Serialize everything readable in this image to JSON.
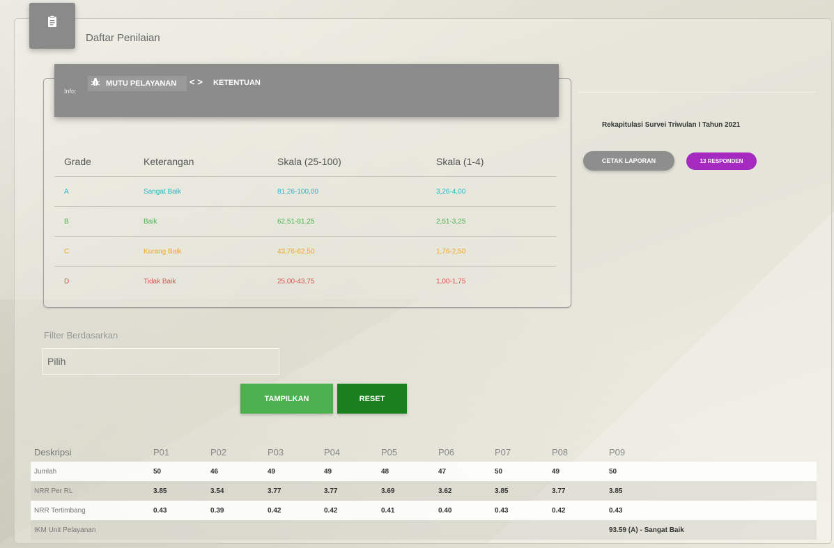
{
  "card": {
    "title": "Daftar Penilaian"
  },
  "info_bar": {
    "label": "Info:",
    "tab_mutu": "MUTU PELAYANAN",
    "tab_ketentuan": "KETENTUAN"
  },
  "grade_table": {
    "headers": [
      "Grade",
      "Keterangan",
      "Skala (25-100)",
      "Skala (1-4)"
    ],
    "rows": [
      {
        "grade": "A",
        "keterangan": "Sangat Baik",
        "skala100": "81,26-100,00",
        "skala4": "3,26-4,00",
        "color": "#29b6c8"
      },
      {
        "grade": "B",
        "keterangan": "Baik",
        "skala100": "62,51-81,25",
        "skala4": "2,51-3,25",
        "color": "#4caf50"
      },
      {
        "grade": "C",
        "keterangan": "Kurang Baik",
        "skala100": "43,76-62,50",
        "skala4": "1,76-2,50",
        "color": "#f5a623"
      },
      {
        "grade": "D",
        "keterangan": "Tidak Baik",
        "skala100": "25,00-43,75",
        "skala4": "1,00-1,75",
        "color": "#e05050"
      }
    ]
  },
  "rekap": {
    "title": "Rekapitulasi Survei Triwulan I Tahun 2021",
    "cetak_label": "CETAK LAPORAN",
    "responden_label": "13 RESPONDEN"
  },
  "filter": {
    "label": "Filter Berdasarkan",
    "selected": "Pilih",
    "tampilkan_label": "TAMPILKAN",
    "reset_label": "RESET"
  },
  "stats": {
    "headers": [
      "Deskripsi",
      "P01",
      "P02",
      "P03",
      "P04",
      "P05",
      "P06",
      "P07",
      "P08",
      "P09"
    ],
    "rows": [
      {
        "desc": "Jumlah",
        "values": [
          "50",
          "46",
          "49",
          "49",
          "48",
          "47",
          "50",
          "49",
          "50"
        ]
      },
      {
        "desc": "NRR Per RL",
        "values": [
          "3.85",
          "3.54",
          "3.77",
          "3.77",
          "3.69",
          "3.62",
          "3.85",
          "3.77",
          "3.85"
        ]
      },
      {
        "desc": "NRR Tertimbang",
        "values": [
          "0.43",
          "0.39",
          "0.42",
          "0.42",
          "0.41",
          "0.40",
          "0.43",
          "0.42",
          "0.43"
        ]
      }
    ],
    "ikm_label": "IKM Unit Pelayanan",
    "ikm_value": "93.59 (A) - Sangat Baik"
  },
  "colors": {
    "responden_badge": "#a52bc0",
    "tampilkan": "#4caf50",
    "reset": "#1b7e1f"
  }
}
